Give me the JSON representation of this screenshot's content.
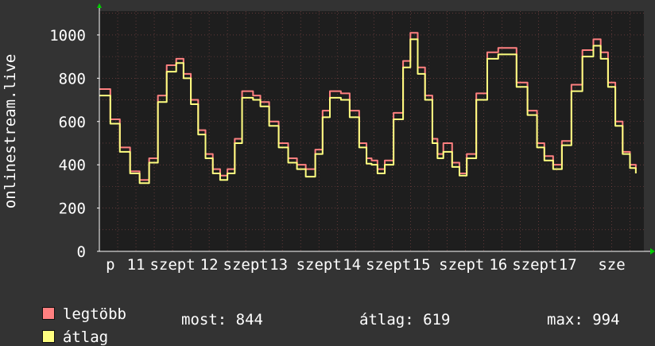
{
  "chart_data": {
    "type": "line",
    "ylabel": "onlinestream.live",
    "yticks": [
      0,
      200,
      400,
      600,
      800,
      1000
    ],
    "ylim": [
      0,
      1110
    ],
    "xlim": [
      0,
      7.44
    ],
    "grid": true,
    "xtick_labels": [
      {
        "label": "p",
        "x": 0.15
      },
      {
        "label": "11",
        "x": 0.5
      },
      {
        "label": "szept",
        "x": 1.0
      },
      {
        "label": "12",
        "x": 1.5
      },
      {
        "label": "szept",
        "x": 2.0
      },
      {
        "label": "13",
        "x": 2.45
      },
      {
        "label": "szept",
        "x": 3.0
      },
      {
        "label": "14",
        "x": 3.45
      },
      {
        "label": "szept",
        "x": 3.95
      },
      {
        "label": "15",
        "x": 4.4
      },
      {
        "label": "szept",
        "x": 4.95
      },
      {
        "label": "16",
        "x": 5.45
      },
      {
        "label": "szept",
        "x": 5.95
      },
      {
        "label": "17",
        "x": 6.4
      },
      {
        "label": "sze",
        "x": 7.0
      }
    ],
    "series": [
      {
        "name": "legtöbb",
        "color": "#ff8080",
        "x": [
          0,
          0.15,
          0.28,
          0.42,
          0.55,
          0.68,
          0.8,
          0.92,
          1.05,
          1.15,
          1.25,
          1.35,
          1.45,
          1.55,
          1.65,
          1.75,
          1.85,
          1.95,
          2.1,
          2.2,
          2.32,
          2.45,
          2.58,
          2.7,
          2.82,
          2.95,
          3.05,
          3.15,
          3.3,
          3.42,
          3.55,
          3.65,
          3.72,
          3.8,
          3.9,
          4.02,
          4.15,
          4.25,
          4.35,
          4.45,
          4.55,
          4.62,
          4.7,
          4.82,
          4.92,
          5.02,
          5.15,
          5.3,
          5.45,
          5.6,
          5.7,
          5.85,
          5.98,
          6.08,
          6.2,
          6.32,
          6.45,
          6.6,
          6.75,
          6.85,
          6.95,
          7.05,
          7.15,
          7.25,
          7.33
        ],
        "y": [
          750,
          610,
          480,
          370,
          330,
          430,
          720,
          860,
          890,
          820,
          700,
          560,
          450,
          380,
          350,
          380,
          520,
          740,
          720,
          690,
          600,
          500,
          430,
          400,
          380,
          470,
          650,
          740,
          730,
          650,
          500,
          430,
          420,
          380,
          420,
          640,
          880,
          1010,
          850,
          720,
          520,
          450,
          500,
          410,
          360,
          450,
          730,
          920,
          940,
          940,
          780,
          650,
          500,
          440,
          400,
          510,
          770,
          930,
          980,
          920,
          780,
          600,
          460,
          400,
          380
        ]
      },
      {
        "name": "átlag",
        "color": "#ffff80",
        "x": [
          0,
          0.15,
          0.28,
          0.42,
          0.55,
          0.68,
          0.8,
          0.92,
          1.05,
          1.15,
          1.25,
          1.35,
          1.45,
          1.55,
          1.65,
          1.75,
          1.85,
          1.95,
          2.1,
          2.2,
          2.32,
          2.45,
          2.58,
          2.7,
          2.82,
          2.95,
          3.05,
          3.15,
          3.3,
          3.42,
          3.55,
          3.65,
          3.72,
          3.8,
          3.9,
          4.02,
          4.15,
          4.25,
          4.35,
          4.45,
          4.55,
          4.62,
          4.7,
          4.82,
          4.92,
          5.02,
          5.15,
          5.3,
          5.45,
          5.6,
          5.7,
          5.85,
          5.98,
          6.08,
          6.2,
          6.32,
          6.45,
          6.6,
          6.75,
          6.85,
          6.95,
          7.05,
          7.15,
          7.25,
          7.33
        ],
        "y": [
          720,
          590,
          460,
          360,
          315,
          410,
          690,
          830,
          870,
          800,
          680,
          540,
          430,
          360,
          330,
          360,
          500,
          710,
          700,
          670,
          580,
          480,
          410,
          380,
          345,
          450,
          620,
          710,
          700,
          620,
          480,
          405,
          400,
          360,
          400,
          610,
          850,
          980,
          820,
          700,
          500,
          430,
          460,
          390,
          350,
          430,
          700,
          890,
          910,
          910,
          760,
          630,
          480,
          420,
          380,
          490,
          740,
          900,
          950,
          890,
          760,
          580,
          450,
          385,
          360
        ]
      }
    ]
  },
  "legend": [
    {
      "label": "legtöbb",
      "color": "#ff8080"
    },
    {
      "label": "átlag",
      "color": "#ffff80"
    }
  ],
  "stats": {
    "most": "most: 844",
    "atlag": "átlag: 619",
    "max": "max: 994"
  }
}
